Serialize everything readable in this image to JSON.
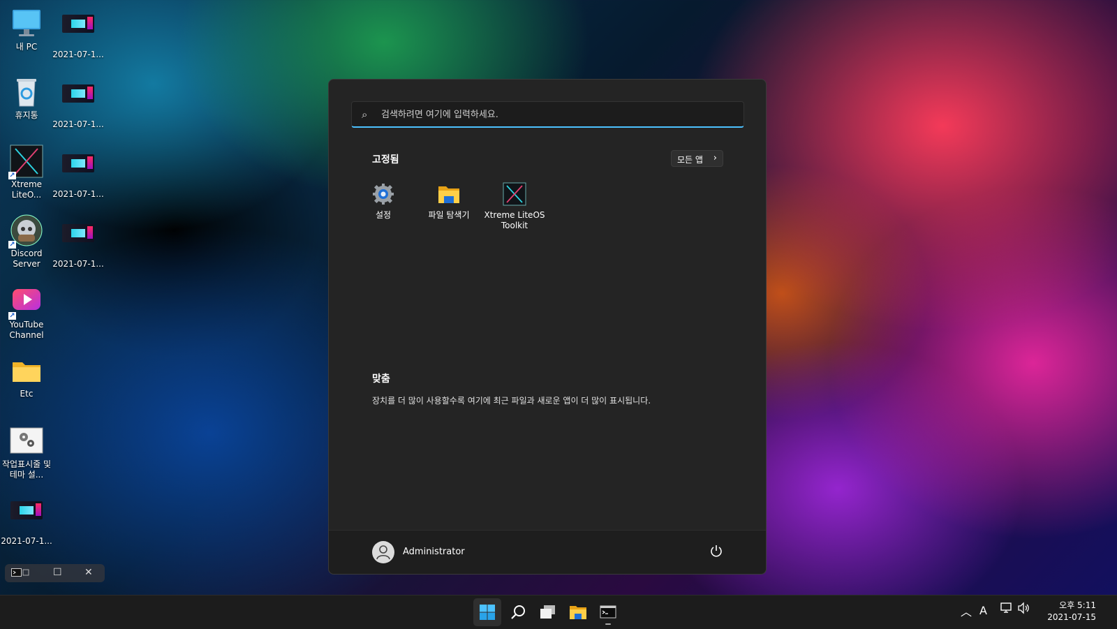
{
  "desktop": {
    "icons": [
      {
        "label": "내 PC"
      },
      {
        "label": "휴지통"
      },
      {
        "label": "Xtreme LiteO..."
      },
      {
        "label": "Discord Server"
      },
      {
        "label": "YouTube Channel"
      },
      {
        "label": "Etc"
      },
      {
        "label": "작업표시줄 및 테마 설..."
      },
      {
        "label": "2021-07-1..."
      }
    ],
    "screenshots": [
      {
        "label": "2021-07-1..."
      },
      {
        "label": "2021-07-1..."
      },
      {
        "label": "2021-07-1..."
      },
      {
        "label": "2021-07-1..."
      }
    ]
  },
  "start_menu": {
    "search_placeholder": "검색하려면 여기에 입력하세요.",
    "pinned_title": "고정됨",
    "all_apps_label": "모든 앱",
    "pinned_apps": [
      {
        "label": "설정"
      },
      {
        "label": "파일 탐색기"
      },
      {
        "label": "Xtreme LiteOS Toolkit"
      }
    ],
    "recommended_title": "맞춤",
    "recommended_text": "장치를 더 많이 사용할수록 여기에 최근 파일과 새로운 앱이 더 많이 표시됩니다.",
    "user_name": "Administrator"
  },
  "taskbar": {
    "input_indicator": "A",
    "time": "오후 5:11",
    "date": "2021-07-15"
  },
  "colors": {
    "accent": "#4cc2ff",
    "start_bg": "#242424",
    "taskbar_bg": "#1c1c1c"
  }
}
